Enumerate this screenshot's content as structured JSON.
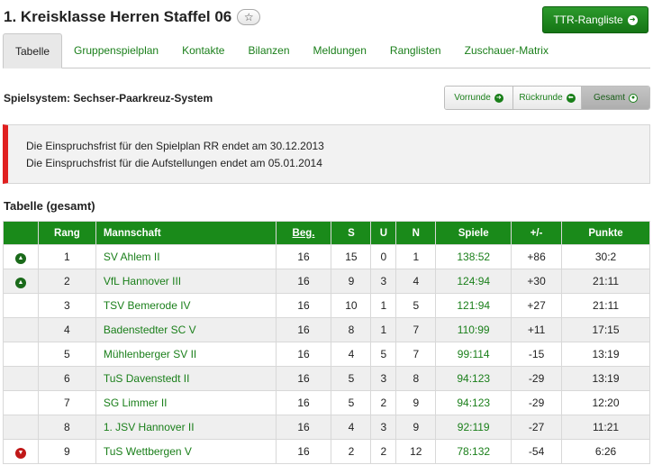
{
  "header": {
    "title": "1. Kreisklasse Herren Staffel 06",
    "ttr_button": "TTR-Rangliste"
  },
  "tabs": [
    {
      "label": "Tabelle",
      "active": true
    },
    {
      "label": "Gruppenspielplan"
    },
    {
      "label": "Kontakte"
    },
    {
      "label": "Bilanzen"
    },
    {
      "label": "Meldungen"
    },
    {
      "label": "Ranglisten"
    },
    {
      "label": "Zuschauer-Matrix"
    }
  ],
  "spielsystem": "Spielsystem: Sechser-Paarkreuz-System",
  "segments": [
    {
      "label": "Vorrunde",
      "icon": "arrow-right-circle-icon"
    },
    {
      "label": "Rückrunde",
      "icon": "arrow-left-circle-icon"
    },
    {
      "label": "Gesamt",
      "icon": "dot-circle-icon",
      "active": true
    }
  ],
  "notice": {
    "line1": "Die Einspruchsfrist für den Spielplan RR endet am 30.12.2013",
    "line2": "Die Einspruchsfrist für die Aufstellungen endet am 05.01.2014"
  },
  "section_title": "Tabelle (gesamt)",
  "table": {
    "headers": {
      "trend": "",
      "rang": "Rang",
      "mannschaft": "Mannschaft",
      "beg": "Beg.",
      "s": "S",
      "u": "U",
      "n": "N",
      "spiele": "Spiele",
      "diff": "+/-",
      "punkte": "Punkte"
    },
    "rows": [
      {
        "trend": "up",
        "rang": "1",
        "team": "SV Ahlem II",
        "beg": "16",
        "s": "15",
        "u": "0",
        "n": "1",
        "spiele": "138:52",
        "diff": "+86",
        "punkte": "30:2"
      },
      {
        "trend": "up",
        "rang": "2",
        "team": "VfL Hannover III",
        "beg": "16",
        "s": "9",
        "u": "3",
        "n": "4",
        "spiele": "124:94",
        "diff": "+30",
        "punkte": "21:11"
      },
      {
        "trend": "",
        "rang": "3",
        "team": "TSV Bemerode IV",
        "beg": "16",
        "s": "10",
        "u": "1",
        "n": "5",
        "spiele": "121:94",
        "diff": "+27",
        "punkte": "21:11"
      },
      {
        "trend": "",
        "rang": "4",
        "team": "Badenstedter SC V",
        "beg": "16",
        "s": "8",
        "u": "1",
        "n": "7",
        "spiele": "110:99",
        "diff": "+11",
        "punkte": "17:15"
      },
      {
        "trend": "",
        "rang": "5",
        "team": "Mühlenberger SV II",
        "beg": "16",
        "s": "4",
        "u": "5",
        "n": "7",
        "spiele": "99:114",
        "diff": "-15",
        "punkte": "13:19"
      },
      {
        "trend": "",
        "rang": "6",
        "team": "TuS Davenstedt II",
        "beg": "16",
        "s": "5",
        "u": "3",
        "n": "8",
        "spiele": "94:123",
        "diff": "-29",
        "punkte": "13:19"
      },
      {
        "trend": "",
        "rang": "7",
        "team": "SG Limmer II",
        "beg": "16",
        "s": "5",
        "u": "2",
        "n": "9",
        "spiele": "94:123",
        "diff": "-29",
        "punkte": "12:20"
      },
      {
        "trend": "",
        "rang": "8",
        "team": "1. JSV Hannover II",
        "beg": "16",
        "s": "4",
        "u": "3",
        "n": "9",
        "spiele": "92:119",
        "diff": "-27",
        "punkte": "11:21"
      },
      {
        "trend": "down",
        "rang": "9",
        "team": "TuS Wettbergen V",
        "beg": "16",
        "s": "2",
        "u": "2",
        "n": "12",
        "spiele": "78:132",
        "diff": "-54",
        "punkte": "6:26"
      }
    ]
  },
  "colors": {
    "accent_green": "#1a8a1a",
    "link_green": "#1a7f1a",
    "alert_red": "#e02020",
    "trend_down": "#c01818"
  }
}
